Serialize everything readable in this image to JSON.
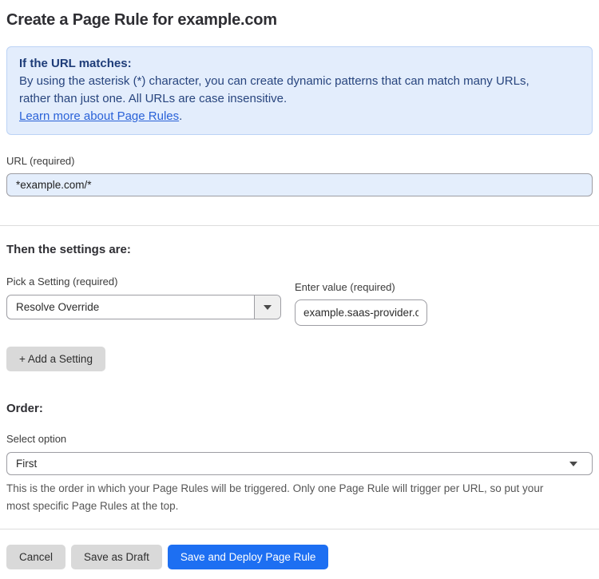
{
  "page": {
    "title": "Create a Page Rule for example.com"
  },
  "info_box": {
    "heading": "If the URL matches:",
    "body_line1": "By using the asterisk (*) character, you can create dynamic patterns that can match many URLs,",
    "body_line2": "rather than just one. All URLs are case insensitive.",
    "link_text": "Learn more about Page Rules",
    "link_suffix": "."
  },
  "url_field": {
    "label": "URL (required)",
    "value": "*example.com/*"
  },
  "settings": {
    "heading": "Then the settings are:",
    "setting_label": "Pick a Setting (required)",
    "setting_selected": "Resolve Override",
    "value_label": "Enter value (required)",
    "value_value": "example.saas-provider.c",
    "add_button_label": "+ Add a Setting"
  },
  "order": {
    "heading": "Order:",
    "select_label": "Select option",
    "selected": "First",
    "help_line1": "This is the order in which your Page Rules will be triggered. Only one Page Rule will trigger per URL, so put your",
    "help_line2": "most specific Page Rules at the top."
  },
  "footer": {
    "cancel_label": "Cancel",
    "save_draft_label": "Save as Draft",
    "save_deploy_label": "Save and Deploy Page Rule"
  },
  "colors": {
    "accent_blue": "#1D6FF2",
    "info_box_bg": "#E3EDFC",
    "info_box_border": "#BCD3F5",
    "info_text": "#28457E",
    "info_heading": "#1E3C78",
    "link_blue": "#2A62D8",
    "url_input_bg": "#E4EEFC",
    "gray_button_bg": "#D9D9D9",
    "divider": "#DDDDDD"
  }
}
